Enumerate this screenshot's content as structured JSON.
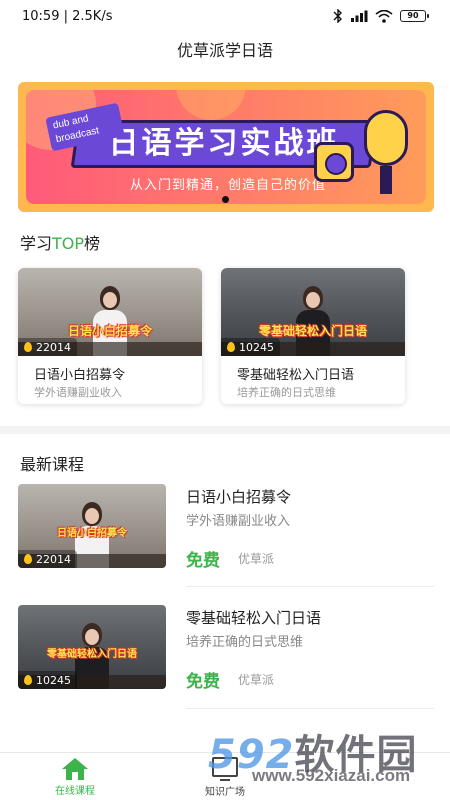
{
  "status_bar": {
    "time": "10:59",
    "speed": "2.5K/s",
    "battery": "90"
  },
  "header": {
    "title": "优草派学日语"
  },
  "banner": {
    "tag": "dub and broadcast",
    "title": "日语学习实战班",
    "subtitle": "从入门到精通，创造自己的价值"
  },
  "top_section": {
    "title_prefix": "学习",
    "title_accent": "TOP",
    "title_suffix": "榜",
    "cards": [
      {
        "cover_text": "日语小白招募令",
        "views": "22014",
        "title": "日语小白招募令",
        "subtitle": "学外语赚副业收入"
      },
      {
        "cover_text": "零基础轻松入门日语",
        "views": "10245",
        "title": "零基础轻松入门日语",
        "subtitle": "培养正确的日式思维"
      }
    ]
  },
  "latest_section": {
    "title": "最新课程",
    "courses": [
      {
        "cover_text": "日语小白招募令",
        "views": "22014",
        "title": "日语小白招募令",
        "subtitle": "学外语赚副业收入",
        "price": "免费",
        "teacher": "优草派"
      },
      {
        "cover_text": "零基础轻松入门日语",
        "views": "10245",
        "title": "零基础轻松入门日语",
        "subtitle": "培养正确的日式思维",
        "price": "免费",
        "teacher": "优草派"
      }
    ]
  },
  "tab_bar": {
    "tabs": [
      {
        "label": "在线课程",
        "icon": "home-icon",
        "active": true
      },
      {
        "label": "知识广场",
        "icon": "monitor-icon",
        "active": false
      }
    ]
  },
  "watermark": {
    "brand_num": "592",
    "brand_text": "软件园",
    "url": "www.592xiazai.com"
  },
  "colors": {
    "accent_green": "#3cb44b",
    "banner_purple": "#6b49d6",
    "banner_orange": "#ffb84d"
  }
}
